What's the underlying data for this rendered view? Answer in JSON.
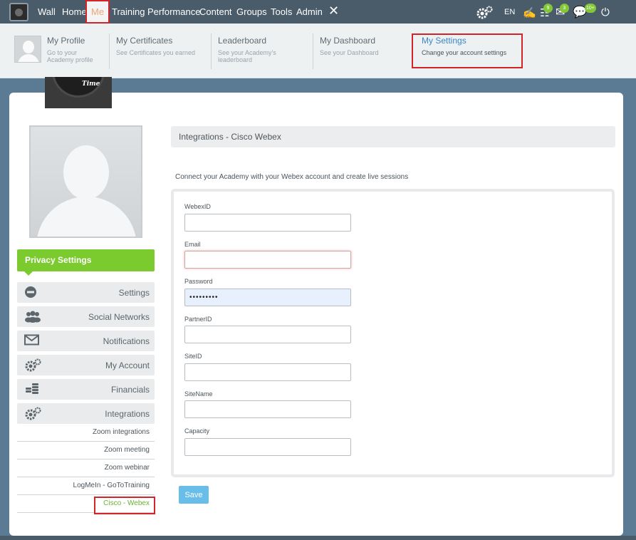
{
  "nav": {
    "items": [
      {
        "label": "Wall"
      },
      {
        "label": "Home"
      },
      {
        "label": "Me"
      },
      {
        "label": "Training"
      },
      {
        "label": "Performance"
      },
      {
        "label": "Content"
      },
      {
        "label": "Groups"
      },
      {
        "label": "Tools"
      },
      {
        "label": "Admin"
      }
    ],
    "language": "EN",
    "badges": {
      "tasks": "9",
      "messages": "3",
      "chat": "10+"
    }
  },
  "mega": {
    "items": [
      {
        "title": "My Profile",
        "sub1": "Go to your",
        "sub2": "Academy profile"
      },
      {
        "title": "My Certificates",
        "sub1": "See Certificates you earned",
        "sub2": ""
      },
      {
        "title": "Leaderboard",
        "sub1": "See your Academy's",
        "sub2": "leaderboard"
      },
      {
        "title": "My Dashboard",
        "sub1": "See your Dashboard",
        "sub2": ""
      },
      {
        "title": "My Settings",
        "sub1": "Change your account settings",
        "sub2": ""
      }
    ]
  },
  "cover": {
    "text": "Time"
  },
  "sidebar": {
    "privacy_label": "Privacy Settings",
    "menu": [
      {
        "label": "Settings",
        "icon": "no-entry-icon"
      },
      {
        "label": "Social Networks",
        "icon": "users-icon"
      },
      {
        "label": "Notifications",
        "icon": "envelope-icon"
      },
      {
        "label": "My Account",
        "icon": "gears-icon"
      },
      {
        "label": "Financials",
        "icon": "coins-icon"
      },
      {
        "label": "Integrations",
        "icon": "gears-icon"
      }
    ],
    "submenu": [
      {
        "label": "Zoom integrations"
      },
      {
        "label": "Zoom meeting"
      },
      {
        "label": "Zoom webinar"
      },
      {
        "label": "LogMeIn - GoToTraining"
      },
      {
        "label": "Cisco - Webex"
      }
    ]
  },
  "content": {
    "header": "Integrations - Cisco Webex",
    "intro": "Connect your Academy with your Webex account and create live sessions",
    "fields": [
      {
        "label": "WebexID",
        "value": ""
      },
      {
        "label": "Email",
        "value": ""
      },
      {
        "label": "Password",
        "value": "•••••••••"
      },
      {
        "label": "PartnerID",
        "value": ""
      },
      {
        "label": "SiteID",
        "value": ""
      },
      {
        "label": "SiteName",
        "value": ""
      },
      {
        "label": "Capacity",
        "value": ""
      }
    ],
    "save_label": "Save"
  },
  "colors": {
    "accent_green": "#7ccb2e",
    "highlight_red": "#d2252b",
    "save_blue": "#69bde9",
    "nav_bg": "#4a5b69"
  }
}
